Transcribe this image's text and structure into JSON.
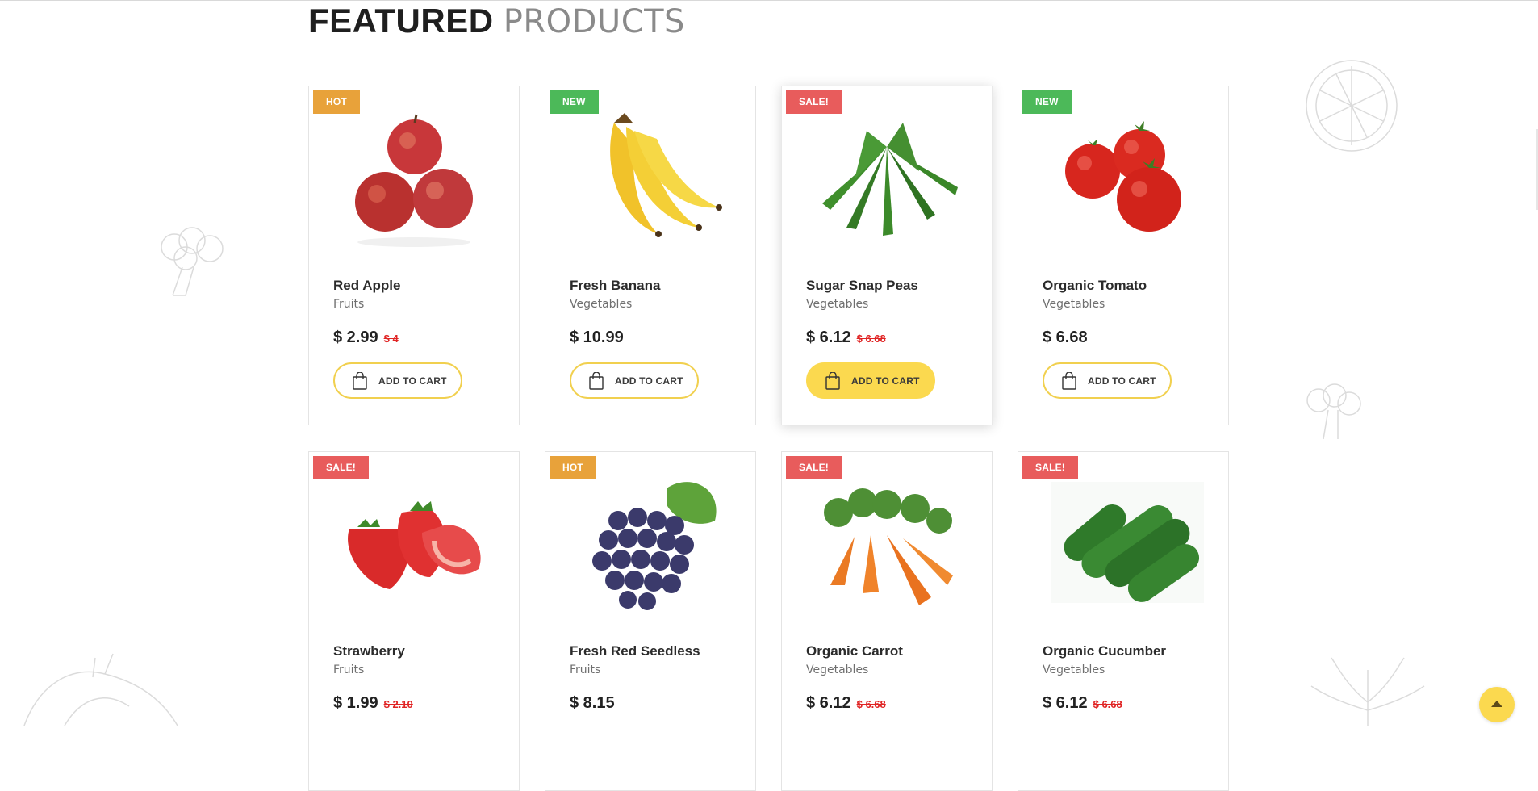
{
  "section": {
    "title_bold": "FEATURED",
    "title_light": "PRODUCTS"
  },
  "colors": {
    "accent": "#fbd94f",
    "hot": "#e8a23a",
    "new": "#4cb959",
    "sale": "#e85c5c",
    "old_price": "#e02424"
  },
  "products": [
    {
      "badge": "HOT",
      "badge_type": "hot",
      "name": "Red Apple",
      "category": "Fruits",
      "price": "$ 2.99",
      "old_price": "$ 4",
      "cta": "ADD TO CART",
      "icon": "apple-image"
    },
    {
      "badge": "NEW",
      "badge_type": "new",
      "name": "Fresh Banana",
      "category": "Vegetables",
      "price": "$ 10.99",
      "old_price": "",
      "cta": "ADD TO CART",
      "icon": "banana-image"
    },
    {
      "badge": "SALE!",
      "badge_type": "sale",
      "name": "Sugar Snap Peas",
      "category": "Vegetables",
      "price": "$ 6.12",
      "old_price": "$ 6.68",
      "cta": "ADD TO CART",
      "icon": "okra-image"
    },
    {
      "badge": "NEW",
      "badge_type": "new",
      "name": "Organic Tomato",
      "category": "Vegetables",
      "price": "$ 6.68",
      "old_price": "",
      "cta": "ADD TO CART",
      "icon": "tomato-image"
    },
    {
      "badge": "SALE!",
      "badge_type": "sale",
      "name": "Strawberry",
      "category": "Fruits",
      "price": "$ 1.99",
      "old_price": "$ 2.10",
      "icon": "strawberry-image"
    },
    {
      "badge": "HOT",
      "badge_type": "hot",
      "name": "Fresh Red Seedless",
      "category": "Fruits",
      "price": "$ 8.15",
      "old_price": "",
      "icon": "grapes-image"
    },
    {
      "badge": "SALE!",
      "badge_type": "sale",
      "name": "Organic Carrot",
      "category": "Vegetables",
      "price": "$ 6.12",
      "old_price": "$ 6.68",
      "icon": "carrot-image"
    },
    {
      "badge": "SALE!",
      "badge_type": "sale",
      "name": "Organic Cucumber",
      "category": "Vegetables",
      "price": "$ 6.12",
      "old_price": "$ 6.68",
      "icon": "cucumber-image"
    }
  ]
}
